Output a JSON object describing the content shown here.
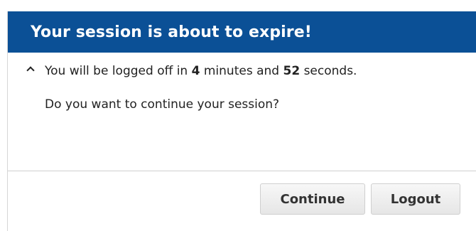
{
  "dialog": {
    "title": "Your session is about to expire!",
    "header_color": "#0b5096",
    "message": {
      "prefix": "You will be logged off in",
      "minutes": "4",
      "minutes_label": "minutes and",
      "seconds": "52",
      "seconds_label": "seconds."
    },
    "question": "Do you want to continue your session?",
    "buttons": {
      "continue_label": "Continue",
      "logout_label": "Logout"
    },
    "icons": {
      "caret": "caret-up-icon"
    }
  }
}
